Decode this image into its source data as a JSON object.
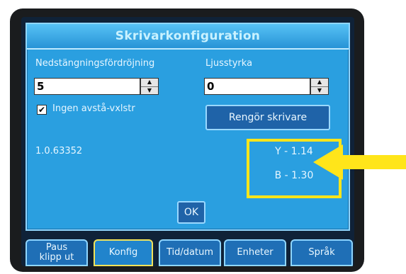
{
  "dialog": {
    "title": "Skrivarkonfiguration",
    "shutdown_delay": {
      "label": "Nedstängningsfördröjning",
      "value": "5"
    },
    "brightness": {
      "label": "Ljusstyrka",
      "value": "0"
    },
    "no_gap_cut": {
      "label": "Ingen avstå-vxlstr",
      "checked": true,
      "mark": "✔"
    },
    "clean_button": "Rengör skrivare",
    "version": "1.0.63352",
    "firmware": {
      "y": "Y - 1.14",
      "b": "B - 1.30"
    },
    "ok_button": "OK"
  },
  "tabs": [
    {
      "line1": "Paus",
      "line2": "klipp ut",
      "active": false
    },
    {
      "line1": "Konfig",
      "line2": "",
      "active": true
    },
    {
      "line1": "Tid/datum",
      "line2": "",
      "active": false
    },
    {
      "line1": "Enheter",
      "line2": "",
      "active": false
    },
    {
      "line1": "Språk",
      "line2": "",
      "active": false
    }
  ],
  "spin_glyphs": {
    "up": "▲",
    "down": "▼"
  },
  "colors": {
    "dialog_bg": "#2a9fe0",
    "highlight": "#ffe51a",
    "arrow": "#ffe51a",
    "button_bg": "#1f63a8"
  }
}
